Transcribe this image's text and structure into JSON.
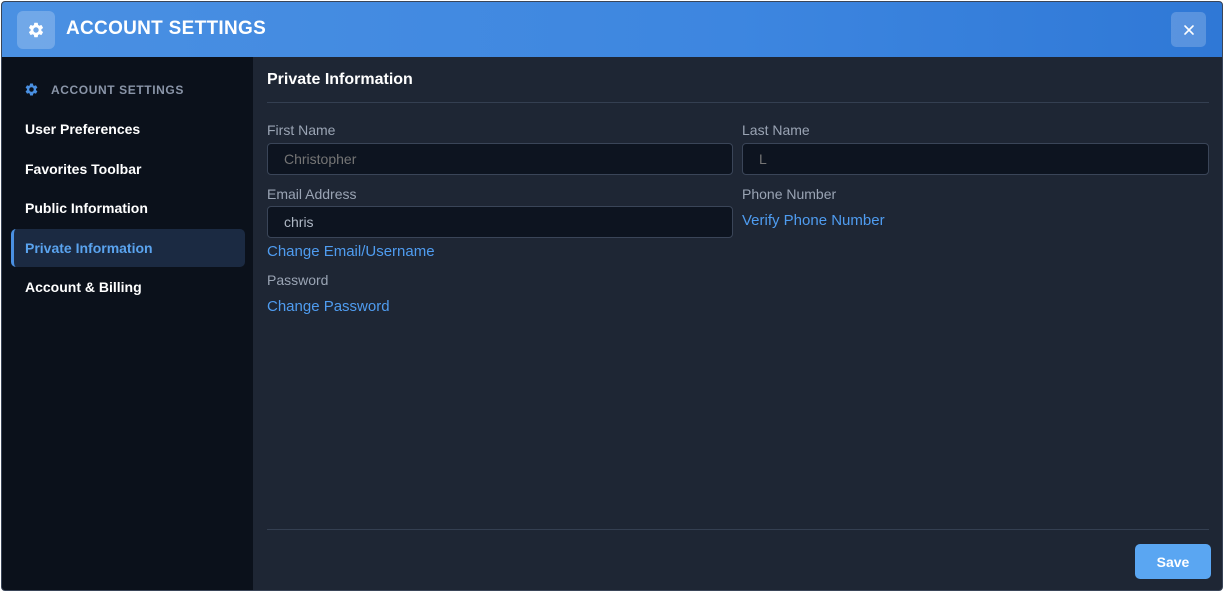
{
  "window": {
    "title": "ACCOUNT SETTINGS",
    "title_icon": "gear-icon",
    "close_icon": "close-icon"
  },
  "sidebar": {
    "header": {
      "icon": "gear-icon",
      "label": "ACCOUNT SETTINGS"
    },
    "items": [
      {
        "label": "User Preferences",
        "active": false
      },
      {
        "label": "Favorites Toolbar",
        "active": false
      },
      {
        "label": "Public Information",
        "active": false
      },
      {
        "label": "Private Information",
        "active": true
      },
      {
        "label": "Account & Billing",
        "active": false
      }
    ]
  },
  "main": {
    "section_title": "Private Information",
    "first_name": {
      "label": "First Name",
      "placeholder": "Christopher"
    },
    "last_name": {
      "label": "Last Name",
      "placeholder": "L"
    },
    "email": {
      "label": "Email Address",
      "value": "chris"
    },
    "change_email_link": "Change Email/Username",
    "phone": {
      "label": "Phone Number",
      "link": "Verify Phone Number"
    },
    "password": {
      "label": "Password",
      "link": "Change Password"
    },
    "save_label": "Save"
  },
  "colors": {
    "accent": "#4a90e2",
    "link": "#4f9cf0",
    "sidebar_bg": "#0b111b",
    "panel_bg": "#1e2634"
  }
}
